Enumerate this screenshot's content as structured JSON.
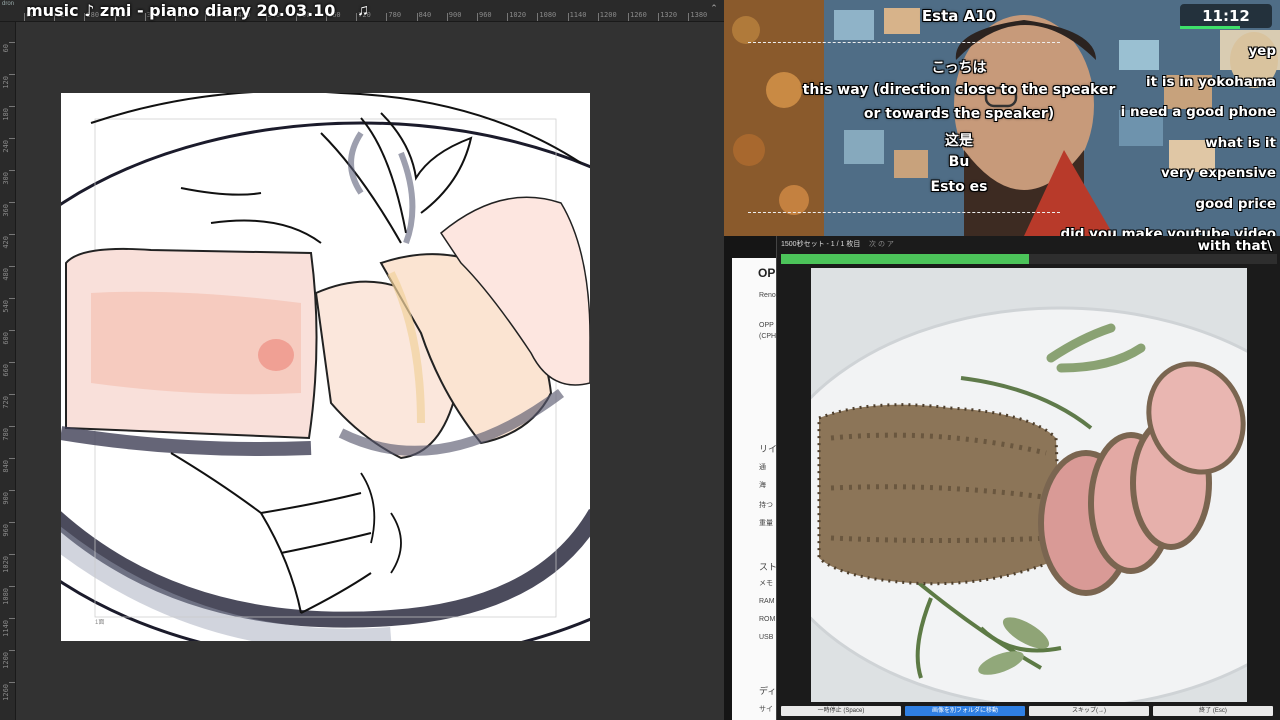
{
  "app": {
    "music_title": "music ♪ zmi - piano diary 20.03.10",
    "music_note": "♫",
    "doc_tab": "dron",
    "ruler_top": [
      "60",
      "120",
      "180",
      "240",
      "300",
      "360",
      "420",
      "480",
      "540",
      "600",
      "660",
      "720",
      "780",
      "840",
      "900",
      "960",
      "1020",
      "1080",
      "1140",
      "1200",
      "1260",
      "1320",
      "1380"
    ],
    "ruler_left": [
      "60",
      "120",
      "180",
      "240",
      "300",
      "360",
      "420",
      "480",
      "540",
      "600",
      "660",
      "720",
      "780",
      "840",
      "900",
      "960",
      "1020",
      "1080",
      "1140",
      "1200",
      "1260"
    ],
    "canvas_mark": "1面"
  },
  "stream": {
    "clock": "11:12",
    "clock_progress": 0.65,
    "subtitles": [
      "Esta A10",
      "こっちは",
      "this way (direction close to the speaker",
      "or towards the speaker)",
      "这是",
      "Bu",
      "Esto es"
    ],
    "chat": [
      "yep",
      "it is in yokohama",
      "i need a good phone",
      "what is it",
      "very expensive",
      "good price",
      "did you make youtube video"
    ],
    "chat_extra": "with that\\"
  },
  "browser": {
    "brand": "OP",
    "lines": [
      "Reno",
      "OPP",
      "(CPH",
      "リイ",
      "通",
      "海",
      "持つ",
      "重量",
      "ストレ",
      "メモ",
      "RAM",
      "ROM",
      "USB",
      "ディ",
      "サイ"
    ]
  },
  "viewer": {
    "title": "1500秒セット - 1 / 1 枚目",
    "next_label": "次 の ア",
    "progress": 0.5,
    "buttons": [
      "一時停止 (Space)",
      "画像を別フォルダに移動",
      "スキップ(→)",
      "終了 (Esc)"
    ]
  },
  "colors": {
    "progress": "#4cc45a",
    "primary_button": "#2f7fe3"
  }
}
